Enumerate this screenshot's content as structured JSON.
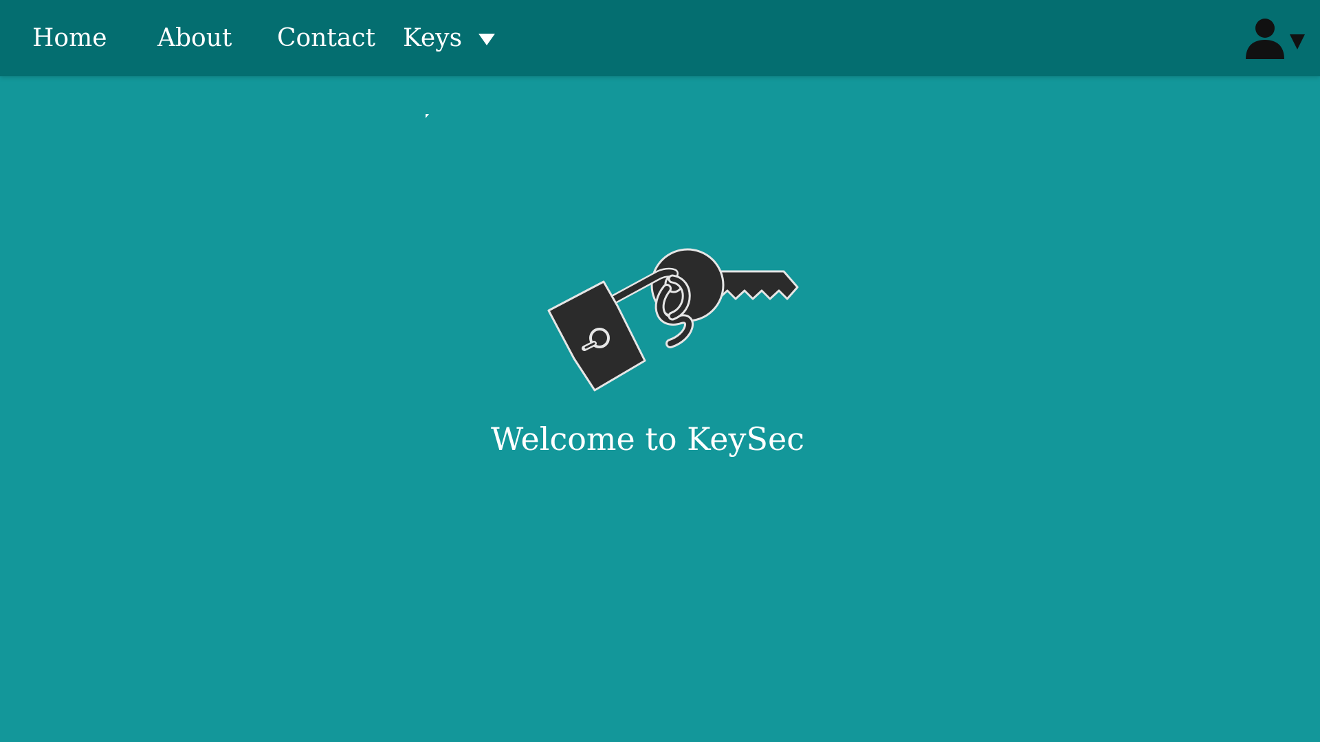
{
  "nav": {
    "items": [
      {
        "label": "Home"
      },
      {
        "label": "About"
      },
      {
        "label": "Contact"
      },
      {
        "label": "Keys",
        "has_dropdown": true
      }
    ],
    "user_menu_icon": "user-icon"
  },
  "hero": {
    "logo_icon": "keys-and-padlock-icon",
    "welcome_text": "Welcome to KeySec"
  },
  "colors": {
    "background": "#13979a",
    "navbar": "#046e70",
    "text": "#ffffff",
    "logo_fill": "#2b2b2b"
  }
}
